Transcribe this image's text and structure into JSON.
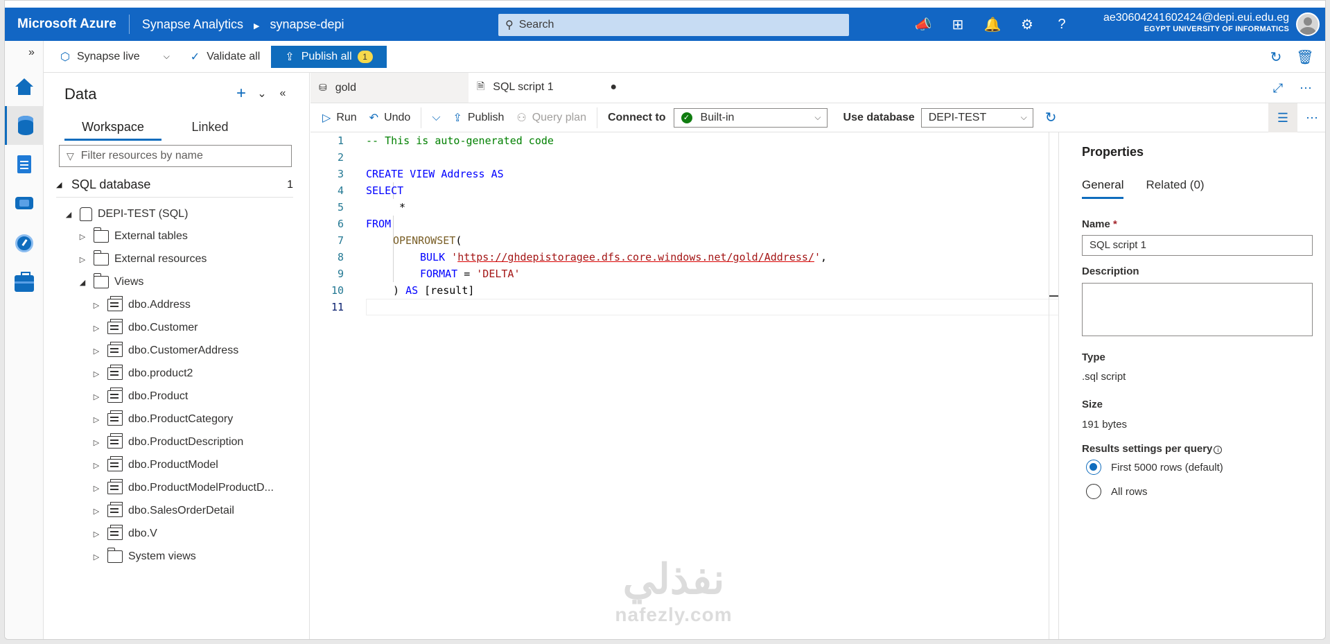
{
  "topbar": {
    "brand": "Microsoft Azure",
    "crumbs": [
      "Synapse Analytics",
      "synapse-depi"
    ],
    "search_placeholder": "Search",
    "icons": [
      "announcement-icon",
      "directory-icon",
      "bell-icon",
      "gear-icon",
      "help-icon"
    ],
    "account_email": "ae30604241602424@depi.eui.edu.eg",
    "account_org": "EGYPT UNIVERSITY OF INFORMATICS"
  },
  "toolbar": {
    "synapse_live": "Synapse live",
    "validate_all": "Validate all",
    "publish_all": "Publish all",
    "publish_badge": "1"
  },
  "data_panel": {
    "title": "Data",
    "tabs": [
      "Workspace",
      "Linked"
    ],
    "filter_placeholder": "Filter resources by name",
    "section": "SQL database",
    "section_count": "1",
    "database": "DEPI-TEST (SQL)",
    "folders": {
      "external_tables": "External tables",
      "external_resources": "External resources",
      "views": "Views",
      "system_views": "System views"
    },
    "views": [
      "dbo.Address",
      "dbo.Customer",
      "dbo.CustomerAddress",
      "dbo.product2",
      "dbo.Product",
      "dbo.ProductCategory",
      "dbo.ProductDescription",
      "dbo.ProductModel",
      "dbo.ProductModelProductD...",
      "dbo.SalesOrderDetail",
      "dbo.V"
    ]
  },
  "editor": {
    "tabs": [
      "gold",
      "SQL script 1"
    ],
    "unsaved_marker": "●",
    "run": "Run",
    "undo": "Undo",
    "publish": "Publish",
    "query_plan": "Query plan",
    "connect_to_label": "Connect to",
    "connect_to_value": "Built-in",
    "use_database_label": "Use database",
    "use_database_value": "DEPI-TEST",
    "line_numbers": [
      "1",
      "2",
      "3",
      "4",
      "5",
      "6",
      "7",
      "8",
      "9",
      "10",
      "11"
    ],
    "code": {
      "l1": "-- This is auto-generated code",
      "l3_kw": "CREATE VIEW",
      "l3_name": " Address ",
      "l3_as": "AS",
      "l4": "SELECT",
      "l5": "*",
      "l6": "FROM",
      "l7_fn": "OPENROWSET",
      "l7_paren": "(",
      "l8_kw": "BULK",
      "l8_q1": "'",
      "l8_url": "https://ghdepistoragee.dfs.core.windows.net/gold/Address/",
      "l8_q2": "'",
      "l8_comma": ",",
      "l9_kw": "FORMAT",
      "l9_eq": " = ",
      "l9_str": "'DELTA'",
      "l10_paren": ") ",
      "l10_kw": "AS",
      "l10_rest": " [result]"
    }
  },
  "properties": {
    "title": "Properties",
    "tabs": [
      "General",
      "Related (0)"
    ],
    "name_label": "Name",
    "required_mark": "*",
    "name_value": "SQL script 1",
    "description_label": "Description",
    "type_label": "Type",
    "type_value": ".sql script",
    "size_label": "Size",
    "size_value": "191 bytes",
    "results_label": "Results settings per query",
    "results_options": [
      "First 5000 rows (default)",
      "All rows"
    ],
    "results_selected": "First 5000 rows (default)"
  },
  "watermark": {
    "arabic": "نفذلي",
    "latin": "nafezly.com"
  },
  "colors": {
    "accent": "#0f6cbd",
    "topbar": "#1266c4",
    "success": "#107c10",
    "code_keyword": "#0000ff",
    "code_comment": "#008000",
    "code_string": "#a31515"
  }
}
